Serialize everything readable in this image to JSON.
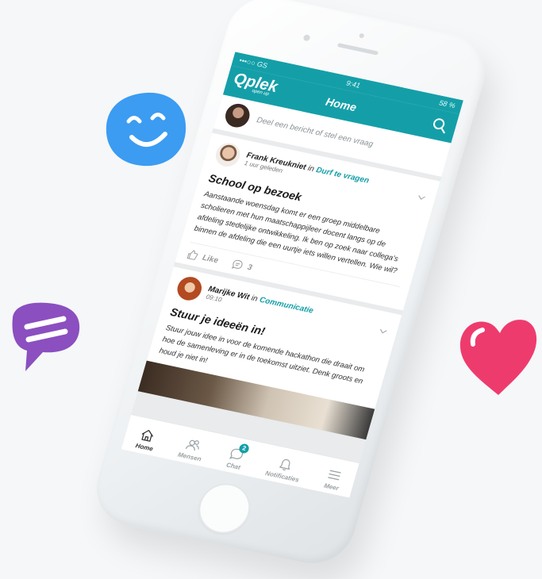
{
  "status_bar": {
    "carrier": "•••○○ GS",
    "time": "9:41",
    "battery": "58 %"
  },
  "app": {
    "logo_text": "Qplek",
    "logo_tagline": "open up",
    "title": "Home",
    "brand_color": "#149fa8"
  },
  "composer": {
    "placeholder": "Deel een bericht of stel een vraag"
  },
  "posts": [
    {
      "author": "Frank Kreukniet",
      "in_label": "in",
      "group": "Durf te vragen",
      "time": "1 uur geleden",
      "title": "School op bezoek",
      "body": "Aanstaande woensdag komt er een groep middelbare scholieren met hun maatschappijleer docent langs op de afdeling stedelijke ontwikkeling. Ik ben op zoek naar collega's binnen de afdeling die een uurtje iets willen vertellen. Wie wil?",
      "like_label": "Like",
      "comment_count": "3"
    },
    {
      "author": "Marijke Wit",
      "in_label": "in",
      "group": "Communicatie",
      "time": "09:10",
      "title": "Stuur je ideeën in!",
      "body": "Stuur jouw idee in voor de komende hackathon die draait om hoe de samenleving er in de toekomst uitziet. Denk groots en houd je niet in!"
    }
  ],
  "tabbar": [
    {
      "label": "Home",
      "icon": "home-icon",
      "active": true
    },
    {
      "label": "Mensen",
      "icon": "people-icon"
    },
    {
      "label": "Chat",
      "icon": "chat-icon",
      "badge": "2"
    },
    {
      "label": "Notificaties",
      "icon": "bell-icon"
    },
    {
      "label": "Meer",
      "icon": "menu-icon"
    }
  ],
  "stickers": {
    "smiley_color": "#3b9cf2",
    "chat_bubble_color": "#8b4fc0",
    "heart_color": "#ee3b6e"
  }
}
